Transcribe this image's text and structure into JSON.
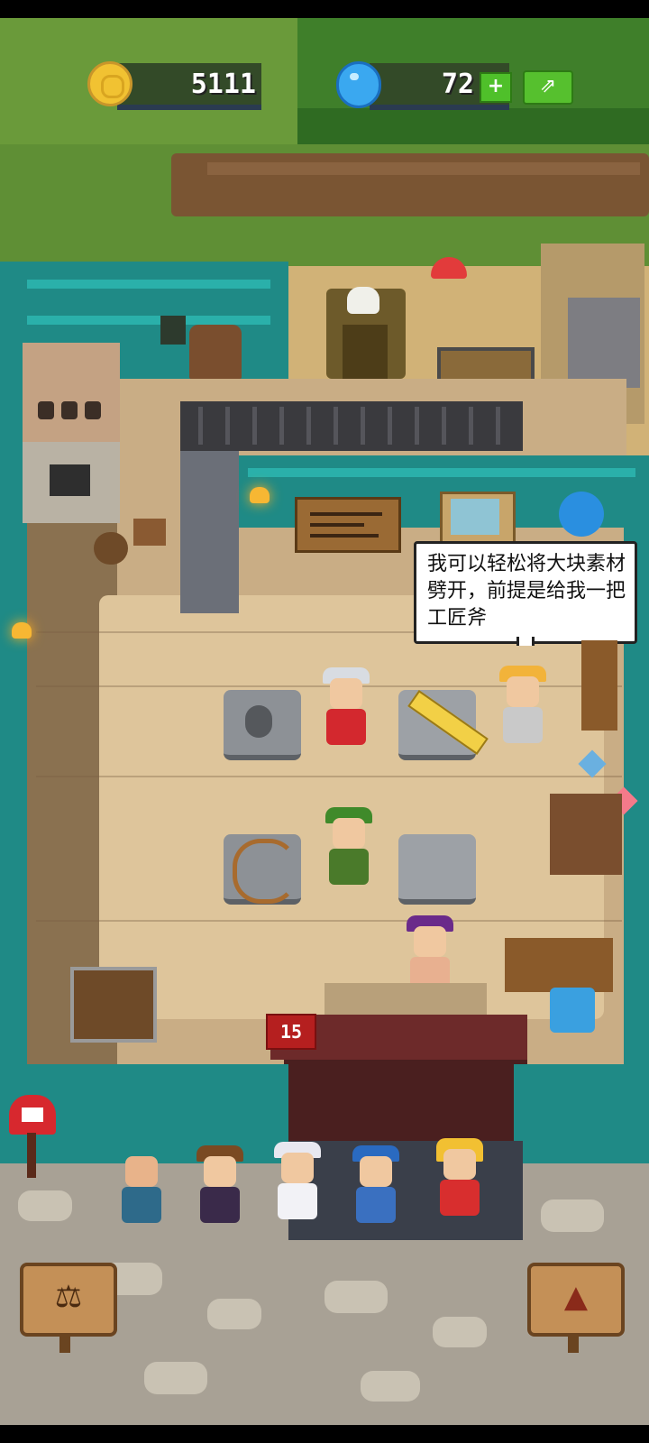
{
  "hud": {
    "coins": "5111",
    "gems": "72",
    "plus_label": "+",
    "share_label": "⇗"
  },
  "dialog": {
    "text": "我可以轻松将大块素材劈开，前提是给我一把工匠斧"
  },
  "counter": {
    "level": "15"
  },
  "icons": {
    "coin": "coin-icon",
    "gem": "gem-icon",
    "mail": "mail-icon",
    "scales": "scales-icon",
    "tent": "tent-icon"
  },
  "colors": {
    "wall": "#1f8a86",
    "floor": "#c9ad85",
    "accent_green": "#4fc02a",
    "level_red": "#b51f1f"
  },
  "queue_characters": [
    "monk",
    "pirate",
    "ice-queen",
    "blue-cap",
    "gold-crown"
  ],
  "bottom_buttons": {
    "left_glyph": "⚖",
    "right_glyph": "▲"
  }
}
